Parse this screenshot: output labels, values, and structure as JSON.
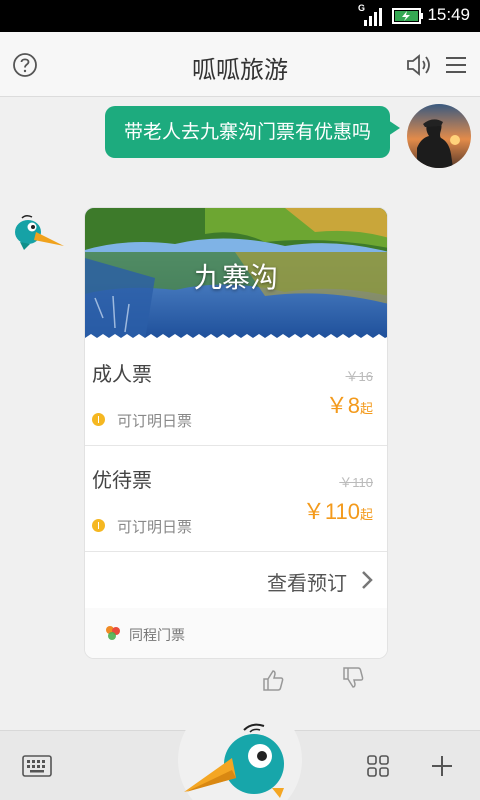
{
  "status": {
    "time": "15:49",
    "network": "G"
  },
  "header": {
    "title": "呱呱旅游",
    "help_icon": "help-icon",
    "speaker_icon": "speaker-icon",
    "menu_icon": "menu-icon"
  },
  "chat": {
    "user_message": "带老人去九寨沟门票有优惠吗",
    "card": {
      "title": "九寨沟",
      "tickets": [
        {
          "name": "成人票",
          "original_price": "￥16",
          "price": "￥8",
          "price_suffix": "起",
          "availability": "可订明日票"
        },
        {
          "name": "优待票",
          "original_price": "￥110",
          "price": "￥110",
          "price_suffix": "起",
          "availability": "可订明日票"
        }
      ],
      "action_label": "查看预订",
      "source": "同程门票"
    }
  },
  "colors": {
    "accent_green": "#1dab7e",
    "price_orange": "#f39a1c",
    "dot_yellow": "#f5b721"
  },
  "bottom": {
    "keyboard_icon": "keyboard-icon",
    "grid_icon": "grid-icon",
    "plus_icon": "plus-icon"
  }
}
